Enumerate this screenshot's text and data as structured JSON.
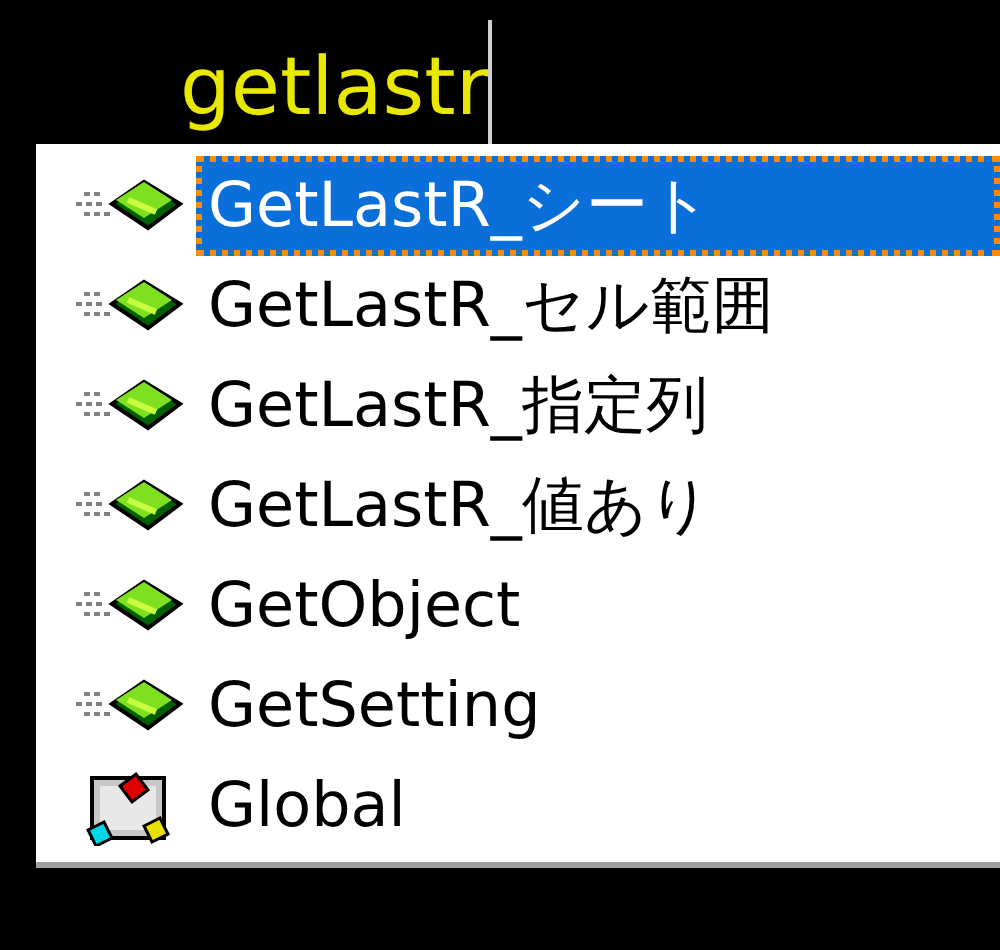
{
  "editor": {
    "typed_text": "getlastr"
  },
  "completion_list": {
    "items": [
      {
        "label": "GetLastR_シート",
        "kind": "method",
        "selected": true
      },
      {
        "label": "GetLastR_セル範囲",
        "kind": "method",
        "selected": false
      },
      {
        "label": "GetLastR_指定列",
        "kind": "method",
        "selected": false
      },
      {
        "label": "GetLastR_値あり",
        "kind": "method",
        "selected": false
      },
      {
        "label": "GetObject",
        "kind": "method",
        "selected": false
      },
      {
        "label": "GetSetting",
        "kind": "method",
        "selected": false
      },
      {
        "label": "Global",
        "kind": "class",
        "selected": false
      }
    ]
  }
}
